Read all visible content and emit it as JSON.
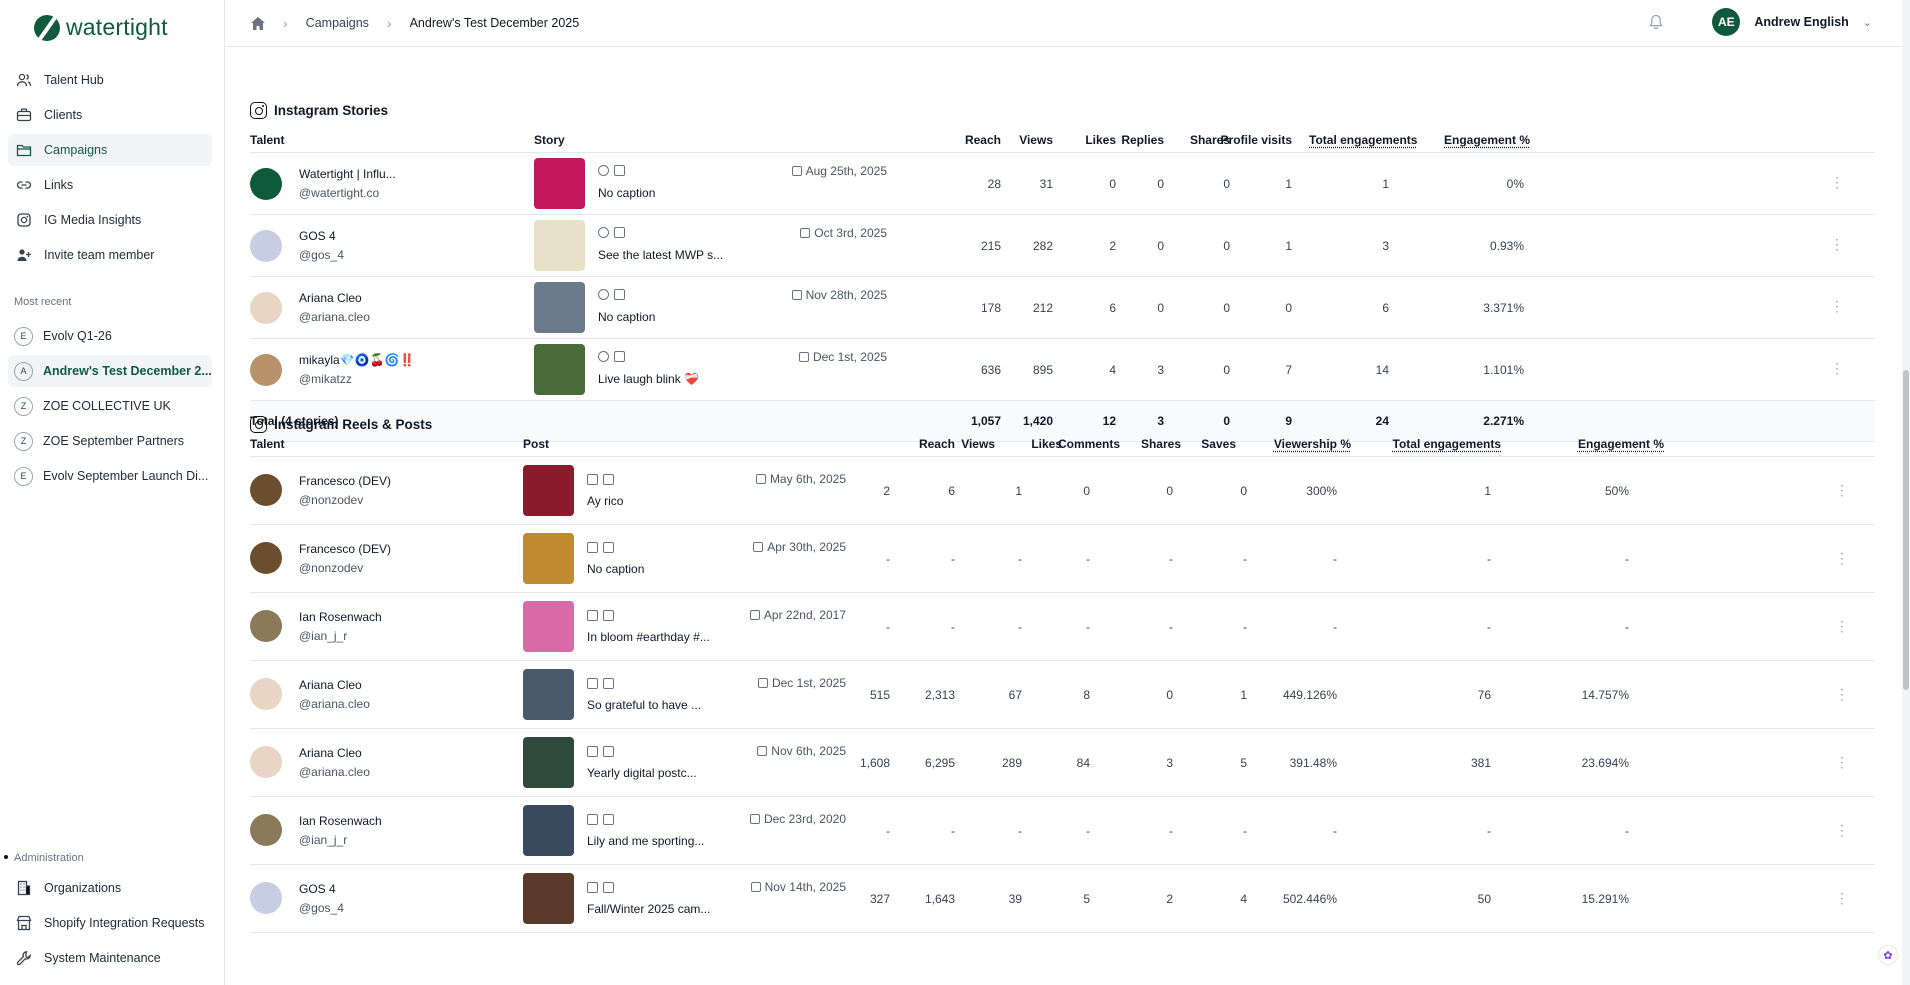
{
  "brand": {
    "name": "watertight",
    "color": "#0f5a3d"
  },
  "nav": [
    {
      "label": "Talent Hub",
      "icon": "users-icon"
    },
    {
      "label": "Clients",
      "icon": "briefcase-icon"
    },
    {
      "label": "Campaigns",
      "icon": "folder-icon",
      "active": true
    },
    {
      "label": "Links",
      "icon": "link-icon"
    },
    {
      "label": "IG Media Insights",
      "icon": "instagram-icon"
    },
    {
      "label": "Invite team member",
      "icon": "user-plus-icon"
    }
  ],
  "recent": {
    "label": "Most recent",
    "items": [
      {
        "badge": "E",
        "label": "Evolv Q1-26"
      },
      {
        "badge": "A",
        "label": "Andrew's Test December 2...",
        "active": true
      },
      {
        "badge": "Z",
        "label": "ZOE COLLECTIVE UK"
      },
      {
        "badge": "Z",
        "label": "ZOE September Partners"
      },
      {
        "badge": "E",
        "label": "Evolv September Launch Di..."
      }
    ]
  },
  "admin": {
    "label": "Administration",
    "items": [
      {
        "label": "Organizations",
        "icon": "building-icon"
      },
      {
        "label": "Shopify Integration Requests",
        "icon": "store-icon"
      },
      {
        "label": "System Maintenance",
        "icon": "wrench-icon"
      }
    ]
  },
  "breadcrumb": {
    "home": "home-icon",
    "campaigns": "Campaigns",
    "current": "Andrew's Test December 2025"
  },
  "user": {
    "initials": "AE",
    "name": "Andrew English"
  },
  "stories": {
    "title": "Instagram Stories",
    "columns": [
      "Talent",
      "Story",
      "Reach",
      "Views",
      "Likes",
      "Replies",
      "Shares",
      "Profile visits",
      "Total engagements",
      "Engagement %"
    ],
    "rows": [
      {
        "name": "Watertight | Influ...",
        "handle": "@watertight.co",
        "caption": "No caption",
        "date": "Aug 25th, 2025",
        "reach": "28",
        "views": "31",
        "likes": "0",
        "replies": "0",
        "shares": "0",
        "profile": "1",
        "total": "1",
        "eng": "0%",
        "avatar": "#0f5a3d",
        "thumb": "#c2185b"
      },
      {
        "name": "GOS 4",
        "handle": "@gos_4",
        "caption": "See the latest MWP s...",
        "date": "Oct 3rd, 2025",
        "reach": "215",
        "views": "282",
        "likes": "2",
        "replies": "0",
        "shares": "0",
        "profile": "1",
        "total": "3",
        "eng": "0.93%",
        "avatar": "#c7cde3",
        "thumb": "#e8e0c8"
      },
      {
        "name": "Ariana Cleo",
        "handle": "@ariana.cleo",
        "caption": "No caption",
        "date": "Nov 28th, 2025",
        "reach": "178",
        "views": "212",
        "likes": "6",
        "replies": "0",
        "shares": "0",
        "profile": "0",
        "total": "6",
        "eng": "3.371%",
        "avatar": "#e9d5c4",
        "thumb": "#6b7b8c"
      },
      {
        "name": "mikayla💎🧿🍒🌀‼️",
        "handle": "@mikatzz",
        "caption": "Live laugh blink ❤️‍🩹",
        "date": "Dec 1st, 2025",
        "reach": "636",
        "views": "895",
        "likes": "4",
        "replies": "3",
        "shares": "0",
        "profile": "7",
        "total": "14",
        "eng": "1.101%",
        "avatar": "#b8926a",
        "thumb": "#4a6b3a"
      }
    ],
    "totals": {
      "label": "Total (4 stories)",
      "reach": "1,057",
      "views": "1,420",
      "likes": "12",
      "replies": "3",
      "shares": "0",
      "profile": "9",
      "total": "24",
      "eng": "2.271%"
    }
  },
  "reels": {
    "title": "Instagram Reels & Posts",
    "columns": [
      "Talent",
      "Post",
      "Reach",
      "Views",
      "Likes",
      "Comments",
      "Shares",
      "Saves",
      "Viewership %",
      "Total engagements",
      "Engagement %"
    ],
    "rows": [
      {
        "name": "Francesco (DEV)",
        "handle": "@nonzodev",
        "caption": "Ay rico",
        "date": "May 6th, 2025",
        "reach": "2",
        "views": "6",
        "likes": "1",
        "comments": "0",
        "shares": "0",
        "saves": "0",
        "viewership": "300%",
        "total": "1",
        "eng": "50%",
        "avatar": "#6b4e2e",
        "thumb": "#8b1a2b"
      },
      {
        "name": "Francesco (DEV)",
        "handle": "@nonzodev",
        "caption": "No caption",
        "date": "Apr 30th, 2025",
        "reach": "-",
        "views": "-",
        "likes": "-",
        "comments": "-",
        "shares": "-",
        "saves": "-",
        "viewership": "-",
        "total": "-",
        "eng": "-",
        "avatar": "#6b4e2e",
        "thumb": "#c28a2e"
      },
      {
        "name": "Ian Rosenwach",
        "handle": "@ian_j_r",
        "caption": "In bloom #earthday #...",
        "date": "Apr 22nd, 2017",
        "reach": "-",
        "views": "-",
        "likes": "-",
        "comments": "-",
        "shares": "-",
        "saves": "-",
        "viewership": "-",
        "total": "-",
        "eng": "-",
        "avatar": "#8a7a5a",
        "thumb": "#d86aa8"
      },
      {
        "name": "Ariana Cleo",
        "handle": "@ariana.cleo",
        "caption": "So grateful to have ...",
        "date": "Dec 1st, 2025",
        "reach": "515",
        "views": "2,313",
        "likes": "67",
        "comments": "8",
        "shares": "0",
        "saves": "1",
        "viewership": "449.126%",
        "total": "76",
        "eng": "14.757%",
        "avatar": "#e9d5c4",
        "thumb": "#4a5a6a"
      },
      {
        "name": "Ariana Cleo",
        "handle": "@ariana.cleo",
        "caption": "Yearly digital postc...",
        "date": "Nov 6th, 2025",
        "reach": "1,608",
        "views": "6,295",
        "likes": "289",
        "comments": "84",
        "shares": "3",
        "saves": "5",
        "viewership": "391.48%",
        "total": "381",
        "eng": "23.694%",
        "avatar": "#e9d5c4",
        "thumb": "#2e4a3a"
      },
      {
        "name": "Ian Rosenwach",
        "handle": "@ian_j_r",
        "caption": "Lily and me sporting...",
        "date": "Dec 23rd, 2020",
        "reach": "-",
        "views": "-",
        "likes": "-",
        "comments": "-",
        "shares": "-",
        "saves": "-",
        "viewership": "-",
        "total": "-",
        "eng": "-",
        "avatar": "#8a7a5a",
        "thumb": "#3a4a5e"
      },
      {
        "name": "GOS 4",
        "handle": "@gos_4",
        "caption": "Fall/Winter 2025 cam...",
        "date": "Nov 14th, 2025",
        "reach": "327",
        "views": "1,643",
        "likes": "39",
        "comments": "5",
        "shares": "2",
        "saves": "4",
        "viewership": "502.446%",
        "total": "50",
        "eng": "15.291%",
        "avatar": "#c7cde3",
        "thumb": "#5a3a2a"
      }
    ]
  }
}
